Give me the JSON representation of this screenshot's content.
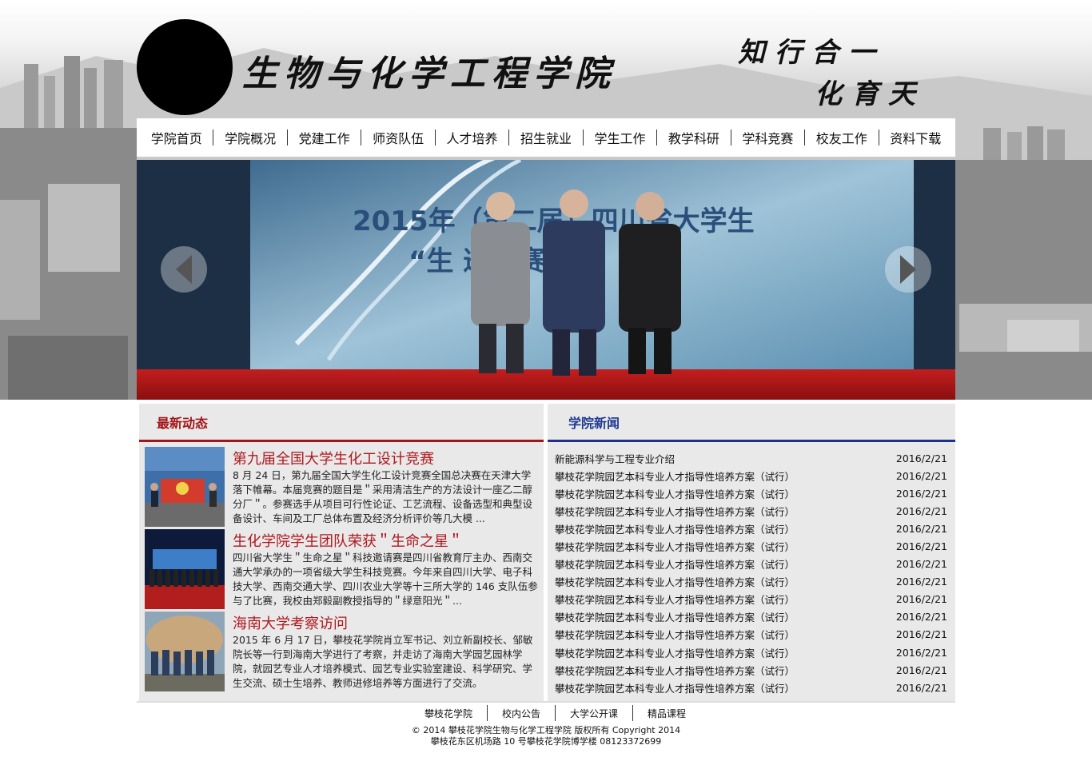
{
  "header": {
    "site_title": "生物与化学工程学院",
    "motto_line1": "知行合一",
    "motto_line2": "化育天工"
  },
  "nav": {
    "items": [
      {
        "label": "学院首页"
      },
      {
        "label": "学院概况"
      },
      {
        "label": "党建工作"
      },
      {
        "label": "师资队伍"
      },
      {
        "label": "人才培养"
      },
      {
        "label": "招生就业"
      },
      {
        "label": "学生工作"
      },
      {
        "label": "教学科研"
      },
      {
        "label": "学科竞赛"
      },
      {
        "label": "校友工作"
      },
      {
        "label": "资料下载"
      }
    ]
  },
  "banner": {
    "slide_text_line1": "2015年（第二届）四川省大学生",
    "slide_text_line2": "“生  邀请赛"
  },
  "latest": {
    "heading": "最新动态",
    "items": [
      {
        "title": "第九届全国大学生化工设计竞赛",
        "text": "8 月 24 日，第九届全国大学生化工设计竞赛全国总决赛在天津大学落下帷幕。本届竞赛的题目是＂采用清洁生产的方法设计一座乙二醇分厂＂。参赛选手从项目可行性论证、工艺流程、设备选型和典型设备设计、车间及工厂总体布置及经济分析评价等几大模 ..."
      },
      {
        "title": "生化学院学生团队荣获＂生命之星＂",
        "text": "四川省大学生＂生命之星＂科技邀请赛是四川省教育厅主办、西南交通大学承办的一项省级大学生科技竞赛。今年来自四川大学、电子科技大学、西南交通大学、四川农业大学等十三所大学的 146 支队伍参与了比赛，我校由郑毅副教授指导的＂绿意阳光＂..."
      },
      {
        "title": "海南大学考察访问",
        "text": "2015 年 6 月 17 日，攀枝花学院肖立军书记、刘立新副校长、邹敏院长等一行到海南大学进行了考察，并走访了海南大学园艺园林学院，就园艺专业人才培养模式、园艺专业实验室建设、科学研究、学生交流、硕士生培养、教师进修培养等方面进行了交流。"
      }
    ]
  },
  "college_news": {
    "heading": "学院新闻",
    "rows": [
      {
        "title": "新能源科学与工程专业介绍",
        "date": "2016/2/21"
      },
      {
        "title": "攀枝花学院园艺本科专业人才指导性培养方案（试行）",
        "date": "2016/2/21"
      },
      {
        "title": "攀枝花学院园艺本科专业人才指导性培养方案（试行）",
        "date": "2016/2/21"
      },
      {
        "title": "攀枝花学院园艺本科专业人才指导性培养方案（试行）",
        "date": "2016/2/21"
      },
      {
        "title": "攀枝花学院园艺本科专业人才指导性培养方案（试行）",
        "date": "2016/2/21"
      },
      {
        "title": "攀枝花学院园艺本科专业人才指导性培养方案（试行）",
        "date": "2016/2/21"
      },
      {
        "title": "攀枝花学院园艺本科专业人才指导性培养方案（试行）",
        "date": "2016/2/21"
      },
      {
        "title": "攀枝花学院园艺本科专业人才指导性培养方案（试行）",
        "date": "2016/2/21"
      },
      {
        "title": "攀枝花学院园艺本科专业人才指导性培养方案（试行）",
        "date": "2016/2/21"
      },
      {
        "title": "攀枝花学院园艺本科专业人才指导性培养方案（试行）",
        "date": "2016/2/21"
      },
      {
        "title": "攀枝花学院园艺本科专业人才指导性培养方案（试行）",
        "date": "2016/2/21"
      },
      {
        "title": "攀枝花学院园艺本科专业人才指导性培养方案（试行）",
        "date": "2016/2/21"
      },
      {
        "title": "攀枝花学院园艺本科专业人才指导性培养方案（试行）",
        "date": "2016/2/21"
      },
      {
        "title": "攀枝花学院园艺本科专业人才指导性培养方案（试行）",
        "date": "2016/2/21"
      }
    ]
  },
  "footer": {
    "links": [
      {
        "label": "攀枝花学院"
      },
      {
        "label": "校内公告"
      },
      {
        "label": "大学公开课"
      },
      {
        "label": "精品课程"
      }
    ],
    "copyright": "© 2014 攀枝花学院生物与化学工程学院 版权所有 Copyright 2014",
    "address": "攀枝花东区机场路 10 号攀枝花学院博学楼 08123372699"
  },
  "colors": {
    "latest_accent": "#a3151a",
    "news_accent": "#1f2f8a",
    "panel_bg": "#e9e9e9"
  }
}
